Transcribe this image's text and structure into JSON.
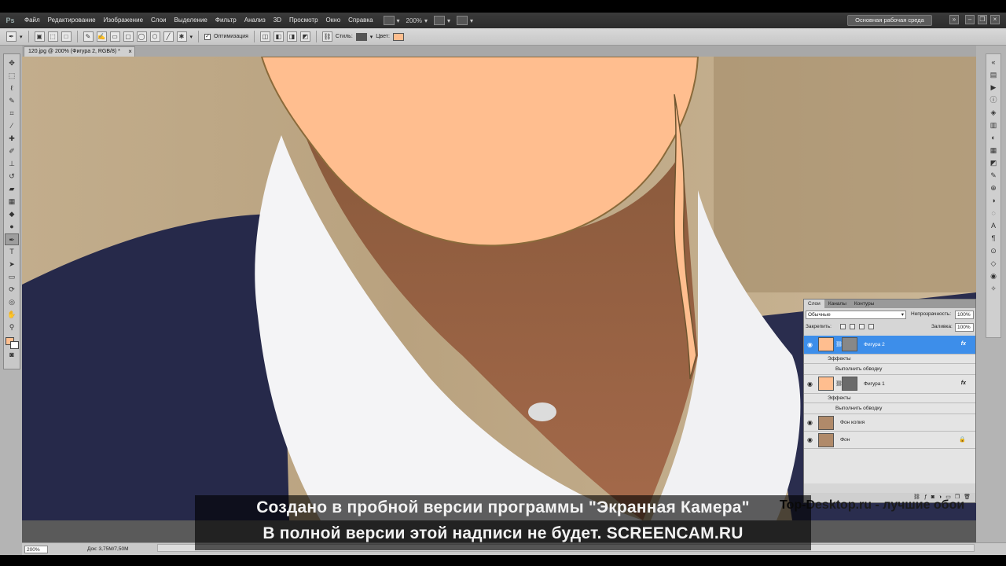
{
  "app": {
    "logo": "Ps"
  },
  "menu": {
    "items": [
      "Файл",
      "Редактирование",
      "Изображение",
      "Слои",
      "Выделение",
      "Фильтр",
      "Анализ",
      "3D",
      "Просмотр",
      "Окно",
      "Справка"
    ],
    "zoom": "200%",
    "workspace": "Основная рабочая среда"
  },
  "options": {
    "optimization_label": "Оптимизация",
    "style_label": "Стиль:",
    "color_label": "Цвет:",
    "color_value": "#ffbe8f",
    "style_swatch": "#555555"
  },
  "document": {
    "tab_title": "120.jpg @ 200% (Фигура 2, RGB/8) *",
    "close": "×"
  },
  "status": {
    "zoom": "200%",
    "doc_info": "Док: 3,75M/7,50M"
  },
  "layers_panel": {
    "tabs": [
      "Слои",
      "Каналы",
      "Контуры"
    ],
    "blend_mode": "Обычные",
    "opacity_label": "Непрозрачность:",
    "opacity": "100%",
    "lock_label": "Закрепить:",
    "fill_label": "Заливка:",
    "fill": "100%",
    "layers": [
      {
        "name": "Фигура 2",
        "effects": "Эффекты",
        "effect": "Выполнить обводку",
        "fx": "fx",
        "selected": true
      },
      {
        "name": "Фигура 1",
        "effects": "Эффекты",
        "effect": "Выполнить обводку",
        "fx": "fx",
        "selected": false
      },
      {
        "name": "Фон копия"
      },
      {
        "name": "Фон"
      }
    ]
  },
  "watermark": {
    "line1": "Создано в пробной версии программы \"Экранная Камера\"",
    "line2": "В полной версии этой надписи не будет. SCREENCAM.RU",
    "site": "Top-Desktop.ru - лучшие обои"
  },
  "colors": {
    "face_fill": "#ffbe8f",
    "selection_blue": "#3d8eea"
  }
}
